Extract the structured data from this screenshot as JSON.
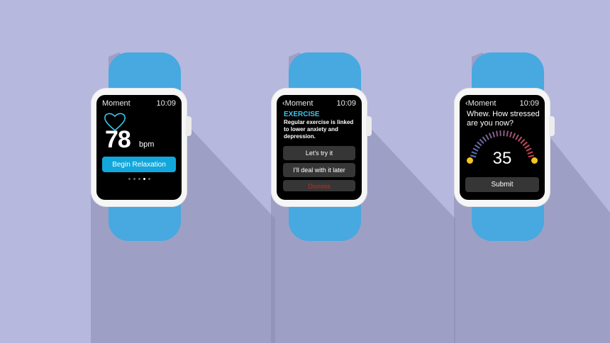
{
  "watch_heart": {
    "app_title": "Moment",
    "time": "10:09",
    "bpm_value": "78",
    "bpm_unit": "bpm",
    "primary_button": "Begin Relaxation",
    "page_count": 5,
    "active_page": 3
  },
  "watch_exercise": {
    "app_title": "‹Moment",
    "time": "10:09",
    "notification_title": "EXERCISE",
    "notification_body": "Regular exercise is linked to lower anxiety and depression.",
    "actions": [
      "Let’s try it",
      "I’ll deal with it later",
      "Dismiss"
    ]
  },
  "watch_stress": {
    "app_title": "‹Moment",
    "time": "10:09",
    "question": "Whew. How stressed are you now?",
    "stress_value": "35",
    "submit_button": "Submit"
  },
  "colors": {
    "background": "#b6b8de",
    "band": "#47a9e0",
    "accent": "#12a7dc",
    "dismiss": "#b9302b"
  }
}
